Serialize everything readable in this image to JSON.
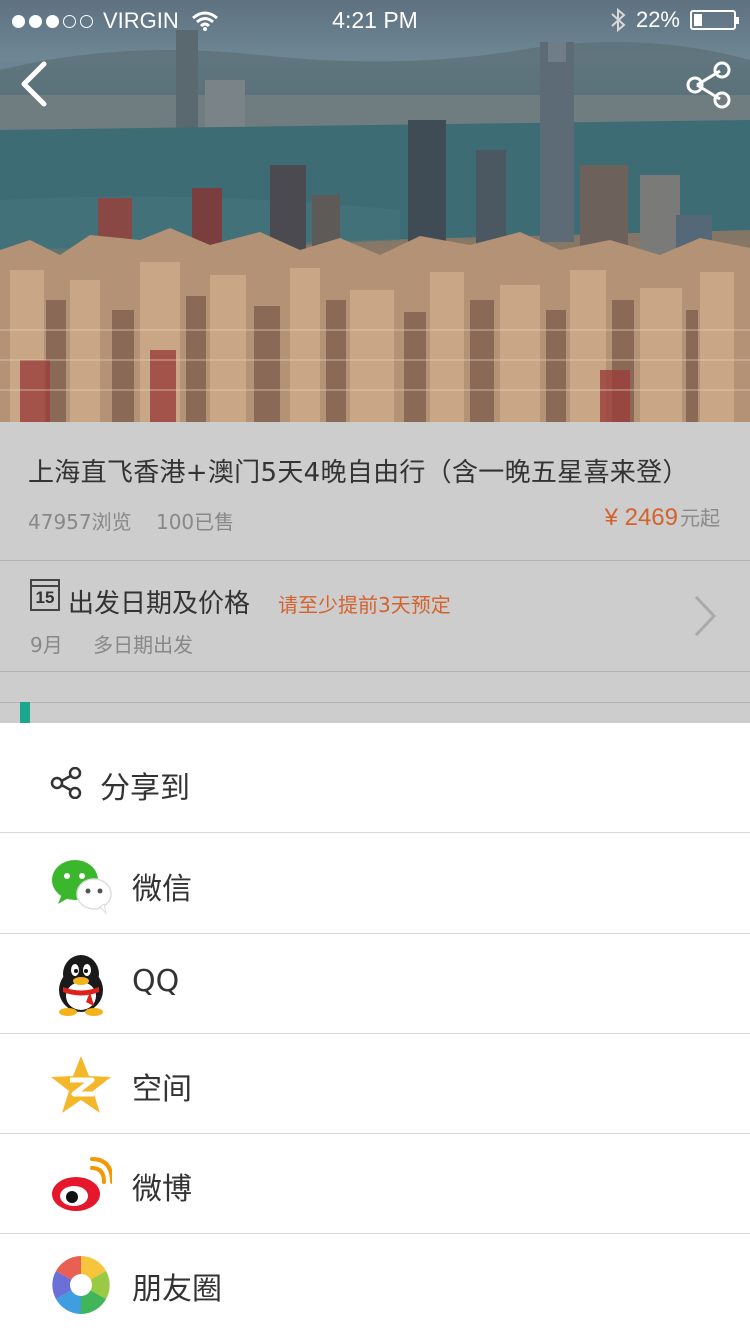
{
  "status_bar": {
    "carrier": "VIRGIN",
    "time": "4:21 PM",
    "battery": "22%",
    "battery_level": 0.22
  },
  "product": {
    "title": "上海直飞香港+澳门5天4晚自由行（含一晚五星喜来登）",
    "views": "47957浏览",
    "sold": "100已售",
    "price": "¥ 2469",
    "price_unit": "元起"
  },
  "date_section": {
    "calendar_day": "15",
    "label": "出发日期及价格",
    "note": "请至少提前3天预定",
    "month": "9月",
    "multi": "多日期出发"
  },
  "share_sheet": {
    "title": "分享到",
    "options": [
      {
        "label": "微信",
        "icon": "wechat-icon"
      },
      {
        "label": "QQ",
        "icon": "qq-icon"
      },
      {
        "label": "空间",
        "icon": "qzone-icon"
      },
      {
        "label": "微博",
        "icon": "weibo-icon"
      },
      {
        "label": "朋友圈",
        "icon": "moments-icon"
      }
    ]
  },
  "colors": {
    "accent": "#d4622c",
    "overlay_gray": "#cdcdcd",
    "teal": "#1aa78e"
  }
}
